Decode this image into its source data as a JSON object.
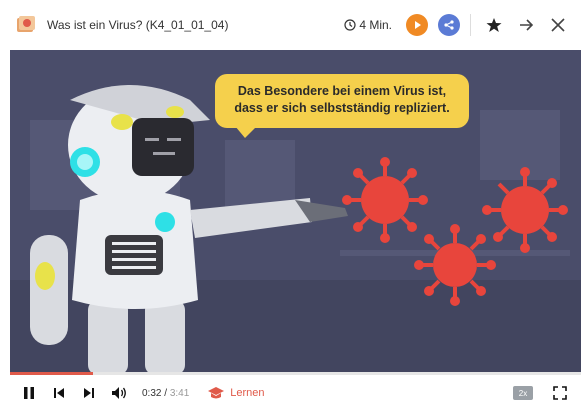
{
  "header": {
    "title": "Was ist ein Virus? (K4_01_01_04)",
    "duration": "4 Min."
  },
  "video": {
    "speech_bubble": "Das Besondere bei einem Virus ist, dass er sich selbstständig repliziert."
  },
  "player": {
    "current_time": "0:32",
    "total_time": "3:41",
    "progress_fraction": 0.145,
    "learn_label": "Lernen",
    "speed_label": "2x"
  },
  "colors": {
    "accent_orange": "#f08a24",
    "accent_blue": "#5b7bd5",
    "progress_red": "#e05a4a",
    "stage_bg": "#4a4d6a",
    "virus_red": "#e8453c",
    "bubble_yellow": "#f5d04c"
  },
  "icons": [
    "course-icon",
    "clock-icon",
    "play-icon",
    "share-icon",
    "star-icon",
    "arrow-right-icon",
    "close-icon",
    "pause-icon",
    "previous-icon",
    "next-icon",
    "volume-icon",
    "graduation-cap-icon",
    "fullscreen-icon"
  ]
}
